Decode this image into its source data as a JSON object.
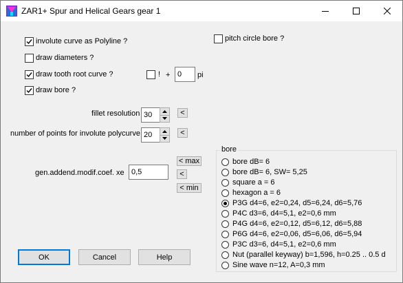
{
  "window": {
    "title": "ZAR1+  Spur and Helical Gears gear 1",
    "controls": [
      "minimize",
      "maximize",
      "close"
    ]
  },
  "options": {
    "involute_polyline": {
      "label": "involute curve as Polyline ?",
      "checked": true
    },
    "draw_diameters": {
      "label": "draw diameters ?",
      "checked": false
    },
    "draw_tooth_root": {
      "label": "draw tooth root curve ?",
      "checked": true
    },
    "draw_bore": {
      "label": "draw bore ?",
      "checked": true
    },
    "pitch_circle_bore": {
      "label": "pitch circle bore ?",
      "checked": false
    },
    "excl": {
      "label": "!",
      "checked": false
    }
  },
  "root_offset": {
    "plus": "+",
    "value": "0",
    "unit": "pi"
  },
  "fillet": {
    "label": "fillet resolution",
    "value": "30",
    "button": "<"
  },
  "points": {
    "label": "number of points for involute polycurve",
    "value": "20",
    "button": "<"
  },
  "addend": {
    "label": "gen.addend.modif.coef. xe",
    "value": "0,5",
    "max_button": "< max",
    "reset_button": "<",
    "min_button": "< min"
  },
  "bore": {
    "title": "bore",
    "selected": 4,
    "options": [
      "bore dB= 6",
      "bore dB= 6, SW= 5,25",
      "square a = 6",
      "hexagon a = 6",
      "P3G d4=6, e2=0,24, d5=6,24, d6=5,76",
      "P4C d3=6, d4=5,1, e2=0,6 mm",
      "P4G d4=6, e2=0,12, d5=6,12, d6=5,88",
      "P6G d4=6, e2=0,06, d5=6,06, d6=5,94",
      "P3C d3=6, d4=5,1, e2=0,6 mm",
      "Nut (parallel keyway) b=1,596, h=0.25 .. 0.5 d",
      "Sine wave n=12, A=0,3 mm"
    ]
  },
  "buttons": {
    "ok": "OK",
    "cancel": "Cancel",
    "help": "Help"
  }
}
